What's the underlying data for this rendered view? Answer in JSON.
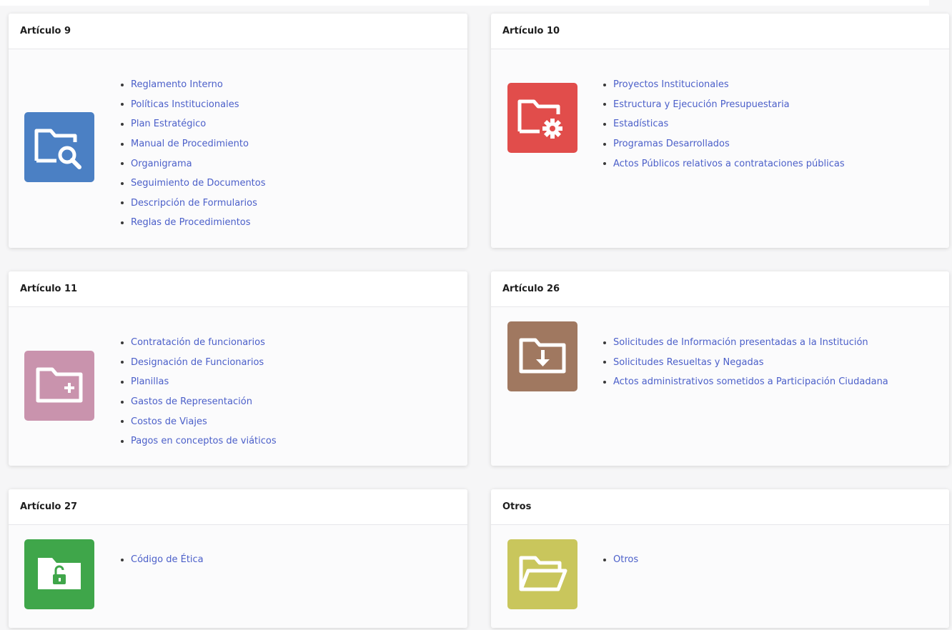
{
  "sections": [
    {
      "title": "Artículo 9",
      "icon": "folder-search-icon",
      "color": "#4b80c4",
      "items": [
        "Reglamento Interno",
        "Políticas Institucionales",
        "Plan Estratégico",
        "Manual de Procedimiento",
        "Organigrama",
        "Seguimiento de Documentos",
        "Descripción de Formularios",
        "Reglas de Procedimientos"
      ]
    },
    {
      "title": "Artículo 10",
      "icon": "folder-settings-icon",
      "color": "#e14d4b",
      "items": [
        "Proyectos Institucionales",
        "Estructura y Ejecución Presupuestaria",
        "Estadísticas",
        "Programas Desarrollados",
        "Actos Públicos relativos a contrataciones públicas"
      ]
    },
    {
      "title": "Artículo 11",
      "icon": "folder-plus-icon",
      "color": "#c993ad",
      "items": [
        "Contratación de funcionarios",
        "Designación de Funcionarios",
        "Planillas",
        "Gastos de Representación",
        "Costos de Viajes",
        "Pagos en conceptos de viáticos"
      ]
    },
    {
      "title": "Artículo 26",
      "icon": "folder-download-icon",
      "color": "#a07860",
      "items": [
        "Solicitudes de Información presentadas a la Institución",
        "Solicitudes Resueltas y Negadas",
        "Actos administrativos sometidos a Participación Ciudadana"
      ]
    },
    {
      "title": "Artículo 27",
      "icon": "folder-unlock-icon",
      "color": "#3fa64a",
      "items": [
        "Código de Ética"
      ]
    },
    {
      "title": "Otros",
      "icon": "folder-open-icon",
      "color": "#c9c65c",
      "items": [
        "Otros"
      ]
    }
  ]
}
